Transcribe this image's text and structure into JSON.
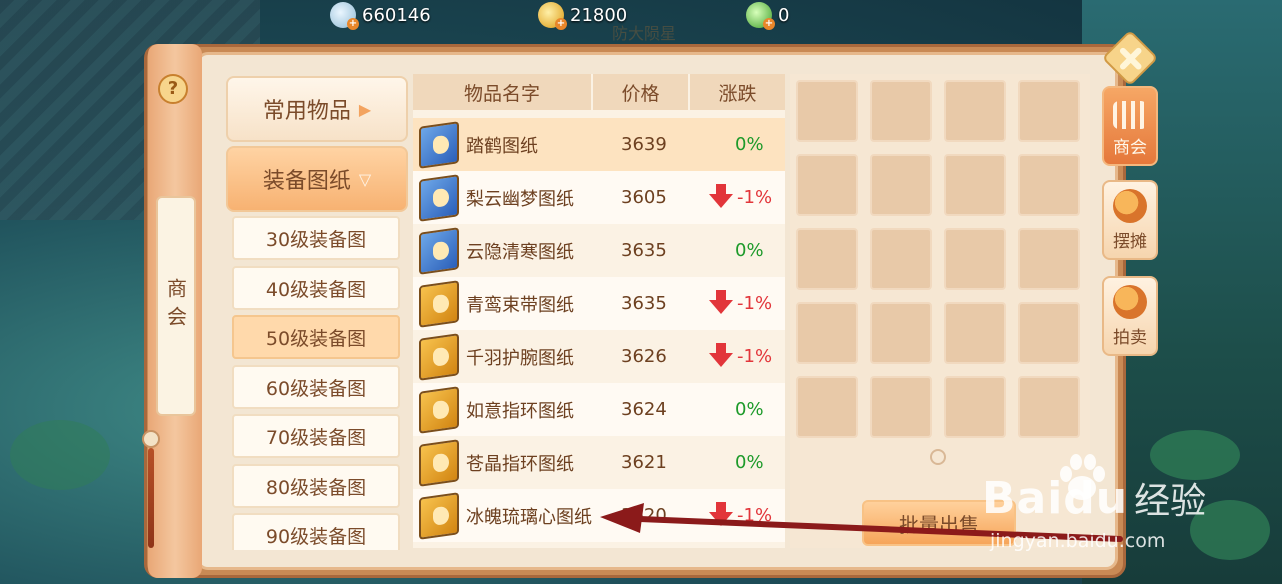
{
  "currencies": [
    {
      "icon": "silver-coin-icon",
      "value": "660146",
      "color": "#bfe0ef"
    },
    {
      "icon": "gold-coin-icon",
      "value": "21800",
      "color": "#f0b726"
    },
    {
      "icon": "jade-coin-icon",
      "value": "0",
      "color": "#8ed16b"
    }
  ],
  "subtitle": "防大陨星",
  "side_tab": {
    "label": "商会",
    "help": "?"
  },
  "categories": {
    "main": [
      {
        "label": "常用物品",
        "arrow": "▶",
        "active": false
      },
      {
        "label": "装备图纸",
        "arrow": "▽",
        "active": true
      }
    ],
    "sub": [
      {
        "label": "30级装备图",
        "active": false
      },
      {
        "label": "40级装备图",
        "active": false
      },
      {
        "label": "50级装备图",
        "active": true
      },
      {
        "label": "60级装备图",
        "active": false
      },
      {
        "label": "70级装备图",
        "active": false
      },
      {
        "label": "80级装备图",
        "active": false
      },
      {
        "label": "90级装备图",
        "active": false
      }
    ]
  },
  "table": {
    "headers": [
      "物品名字",
      "价格",
      "涨跌"
    ],
    "rows": [
      {
        "icon": "blue-blueprint-icon",
        "name": "踏鹤图纸",
        "price": "3639",
        "change": "0%",
        "trend": "flat"
      },
      {
        "icon": "blue-blueprint-icon",
        "name": "梨云幽梦图纸",
        "price": "3605",
        "change": "-1%",
        "trend": "down"
      },
      {
        "icon": "blue-blueprint-icon",
        "name": "云隐清寒图纸",
        "price": "3635",
        "change": "0%",
        "trend": "flat"
      },
      {
        "icon": "gold-blueprint-icon",
        "name": "青鸾束带图纸",
        "price": "3635",
        "change": "-1%",
        "trend": "down"
      },
      {
        "icon": "gold-blueprint-icon",
        "name": "千羽护腕图纸",
        "price": "3626",
        "change": "-1%",
        "trend": "down"
      },
      {
        "icon": "gold-blueprint-icon",
        "name": "如意指环图纸",
        "price": "3624",
        "change": "0%",
        "trend": "flat"
      },
      {
        "icon": "gold-blueprint-icon",
        "name": "苍晶指环图纸",
        "price": "3621",
        "change": "0%",
        "trend": "flat"
      },
      {
        "icon": "gold-blueprint-icon",
        "name": "冰魄琉璃心图纸",
        "price": "3620",
        "change": "-1%",
        "trend": "down"
      }
    ]
  },
  "inventory": {
    "slot_count": 20,
    "sell_button": "批量出售"
  },
  "right_tabs": [
    {
      "label": "商会",
      "icon": "guild-icon",
      "active": true
    },
    {
      "label": "摆摊",
      "icon": "stall-coins-icon",
      "active": false
    },
    {
      "label": "拍卖",
      "icon": "auction-coins-icon",
      "active": false
    }
  ],
  "watermark": {
    "logo": "Baidu",
    "suffix": "经验",
    "url": "jingyan.baidu.com"
  },
  "colors": {
    "up_flat": "#1d9a2a",
    "down": "#e2353a",
    "accent": "#e5783b"
  }
}
